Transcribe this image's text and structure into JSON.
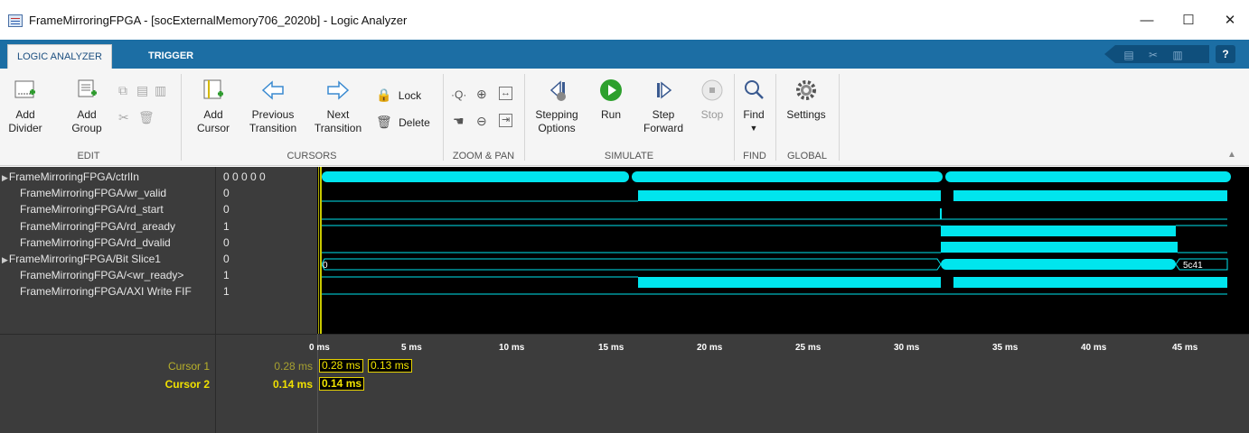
{
  "window": {
    "title": "FrameMirroringFPGA - [socExternalMemory706_2020b] - Logic Analyzer",
    "minimize": "—",
    "maximize": "☐",
    "close": "✕"
  },
  "tabs": [
    {
      "label": "LOGIC ANALYZER",
      "active": true
    },
    {
      "label": "TRIGGER",
      "active": false
    }
  ],
  "quick_access": {
    "help": "?"
  },
  "ribbon": {
    "edit": {
      "add_divider": [
        "Add",
        "Divider"
      ],
      "add_group": [
        "Add",
        "Group"
      ],
      "group_label": "EDIT"
    },
    "cursors": {
      "add_cursor": [
        "Add",
        "Cursor"
      ],
      "previous_transition": [
        "Previous",
        "Transition"
      ],
      "next_transition": [
        "Next",
        "Transition"
      ],
      "lock": "Lock",
      "delete": "Delete",
      "group_label": "CURSORS"
    },
    "zoom_pan": {
      "group_label": "ZOOM & PAN"
    },
    "simulate": {
      "stepping_options": [
        "Stepping",
        "Options"
      ],
      "run": "Run",
      "step_forward": [
        "Step",
        "Forward"
      ],
      "stop": "Stop",
      "group_label": "SIMULATE"
    },
    "find": {
      "find": "Find",
      "group_label": "FIND"
    },
    "global": {
      "settings": "Settings",
      "group_label": "GLOBAL"
    }
  },
  "signals": [
    {
      "name": "FrameMirroringFPGA/ctrlIn",
      "value": "0 0 0 0 0",
      "expandable": true
    },
    {
      "name": "FrameMirroringFPGA/wr_valid",
      "value": "0",
      "expandable": false
    },
    {
      "name": "FrameMirroringFPGA/rd_start",
      "value": "0",
      "expandable": false
    },
    {
      "name": "FrameMirroringFPGA/rd_aready",
      "value": "1",
      "expandable": false
    },
    {
      "name": "FrameMirroringFPGA/rd_dvalid",
      "value": "0",
      "expandable": false
    },
    {
      "name": "FrameMirroringFPGA/Bit Slice1",
      "value": "0",
      "expandable": true
    },
    {
      "name": "FrameMirroringFPGA/<wr_ready>",
      "value": "1",
      "expandable": false
    },
    {
      "name": "FrameMirroringFPGA/AXI Write FIF",
      "value": "1",
      "expandable": false
    }
  ],
  "waveform": {
    "bus_labels": {
      "bit_slice_start": "0",
      "bit_slice_end": "5c41"
    },
    "colors": {
      "wave": "#00e5ee",
      "cursor": "#c8c800",
      "background": "#000000"
    }
  },
  "time_axis": {
    "ticks": [
      "0 ms",
      "5 ms",
      "10 ms",
      "15 ms",
      "20 ms",
      "25 ms",
      "30 ms",
      "35 ms",
      "40 ms",
      "45 ms"
    ]
  },
  "cursors": [
    {
      "label": "Cursor 1",
      "value": "0.28 ms",
      "box1": "0.28 ms",
      "box2": "0.13 ms"
    },
    {
      "label": "Cursor 2",
      "value": "0.14 ms",
      "box1": "0.14 ms"
    }
  ]
}
